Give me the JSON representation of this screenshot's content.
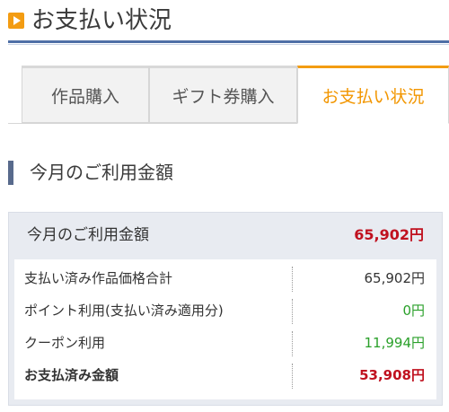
{
  "header": {
    "title": "お支払い状況",
    "icon": "play-square-icon",
    "icon_color": "#f39c12",
    "rule_color": "#4f6fa6"
  },
  "tabs": [
    {
      "label": "作品購入",
      "active": false
    },
    {
      "label": "ギフト券購入",
      "active": false
    },
    {
      "label": "お支払い状況",
      "active": true
    }
  ],
  "colors": {
    "accent": "#f39c12",
    "amount_red": "#c0111f",
    "amount_green": "#2aa02a",
    "section_bar": "#586a8c",
    "box_bg": "#e8ebf1"
  },
  "section": {
    "title": "今月のご利用金額"
  },
  "summary": {
    "label": "今月のご利用金額",
    "value": "65,902円",
    "rows": [
      {
        "label": "支払い済み作品価格合計",
        "value": "65,902円"
      },
      {
        "label": "ポイント利用(支払い済み適用分)",
        "value": "0円"
      },
      {
        "label": "クーポン利用",
        "value": "11,994円"
      },
      {
        "label": "お支払済み金額",
        "value": "53,908円"
      }
    ]
  }
}
